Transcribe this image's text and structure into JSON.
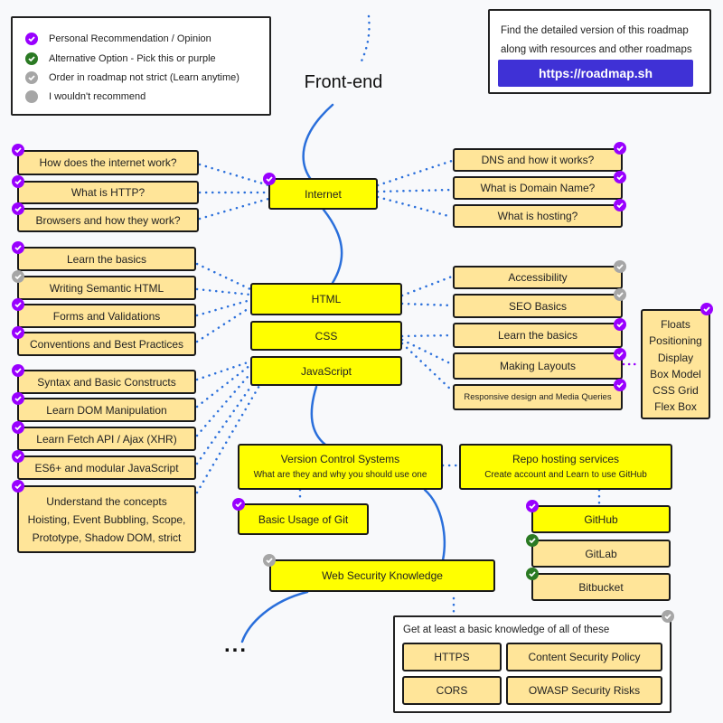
{
  "title": "Front-end",
  "ellipsis": "...",
  "colors": {
    "main_node": "#ffff00",
    "sub_node": "#ffe599",
    "link_button": "#3f31d6",
    "connector": "#2a6fdb",
    "purple_badge": "#9900ff",
    "green_badge": "#2b7a23",
    "gray_badge": "#a6a6a6"
  },
  "legend": {
    "items": [
      {
        "icon": "purple-check-icon",
        "label": "Personal Recommendation / Opinion"
      },
      {
        "icon": "green-check-icon",
        "label": "Alternative Option - Pick this or purple"
      },
      {
        "icon": "gray-check-icon",
        "label": "Order in roadmap not strict (Learn anytime)"
      },
      {
        "icon": "gray-circle-icon",
        "label": "I wouldn't recommend"
      }
    ]
  },
  "promo": {
    "line1": "Find the detailed version of this roadmap",
    "line2": "along with resources and other roadmaps",
    "button": "https://roadmap.sh"
  },
  "internet": {
    "label": "Internet",
    "left": [
      "How does the internet work?",
      "What is HTTP?",
      "Browsers and how they work?"
    ],
    "right": [
      "DNS and how it works?",
      "What is Domain Name?",
      "What is hosting?"
    ]
  },
  "html": {
    "label": "HTML",
    "left": [
      "Learn the basics",
      "Writing Semantic HTML",
      "Forms and Validations",
      "Conventions and Best Practices"
    ]
  },
  "css": {
    "label": "CSS"
  },
  "javascript": {
    "label": "JavaScript",
    "left": [
      "Syntax and Basic Constructs",
      "Learn DOM Manipulation",
      "Learn Fetch API / Ajax (XHR)",
      "ES6+ and modular JavaScript"
    ],
    "concepts": [
      "Understand the concepts",
      "Hoisting, Event Bubbling, Scope,",
      "Prototype, Shadow DOM, strict"
    ]
  },
  "html_css_right": [
    "Accessibility",
    "SEO Basics",
    "Learn the basics",
    "Making Layouts",
    "Responsive design and Media Queries"
  ],
  "layouts": [
    "Floats",
    "Positioning",
    "Display",
    "Box Model",
    "CSS Grid",
    "Flex Box"
  ],
  "vcs": {
    "title": "Version Control Systems",
    "subtitle": "What are they and why you should use one",
    "git": "Basic Usage of Git"
  },
  "repo": {
    "title": "Repo hosting services",
    "subtitle": "Create account and Learn to use GitHub",
    "services": [
      "GitHub",
      "GitLab",
      "Bitbucket"
    ]
  },
  "security": {
    "label": "Web Security Knowledge",
    "intro": "Get at least a basic knowledge of all of these",
    "items": [
      "HTTPS",
      "Content Security Policy",
      "CORS",
      "OWASP Security Risks"
    ]
  }
}
